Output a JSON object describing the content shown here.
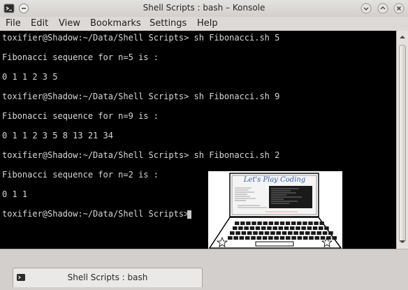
{
  "window": {
    "title": "Shell Scripts : bash – Konsole",
    "app_icon": "konsole-icon",
    "pin_icon": "pin-icon",
    "buttons": [
      "minimize-icon",
      "maximize-icon",
      "close-icon"
    ]
  },
  "menu": {
    "items": [
      "File",
      "Edit",
      "View",
      "Bookmarks",
      "Settings",
      "Help"
    ]
  },
  "terminal": {
    "lines": [
      "toxifier@Shadow:~/Data/Shell Scripts> sh Fibonacci.sh 5",
      "",
      "Fibonacci sequence for n=5 is :",
      "",
      "0 1 1 2 3 5",
      "",
      "toxifier@Shadow:~/Data/Shell Scripts> sh Fibonacci.sh 9",
      "",
      "Fibonacci sequence for n=9 is :",
      "",
      "0 1 1 2 3 5 8 13 21 34",
      "",
      "toxifier@Shadow:~/Data/Shell Scripts> sh Fibonacci.sh 2",
      "",
      "Fibonacci sequence for n=2 is :",
      "",
      "0 1 1",
      "",
      "toxifier@Shadow:~/Data/Shell Scripts> "
    ],
    "foreground": "#d8d8d8",
    "background": "#000000"
  },
  "tabs": [
    {
      "label": "Shell Scripts : bash",
      "icon": "terminal-tab-icon"
    }
  ],
  "logo": {
    "heading": "Let's Play Coding",
    "url": "http://letsplaycoding.blogspot.com/"
  }
}
